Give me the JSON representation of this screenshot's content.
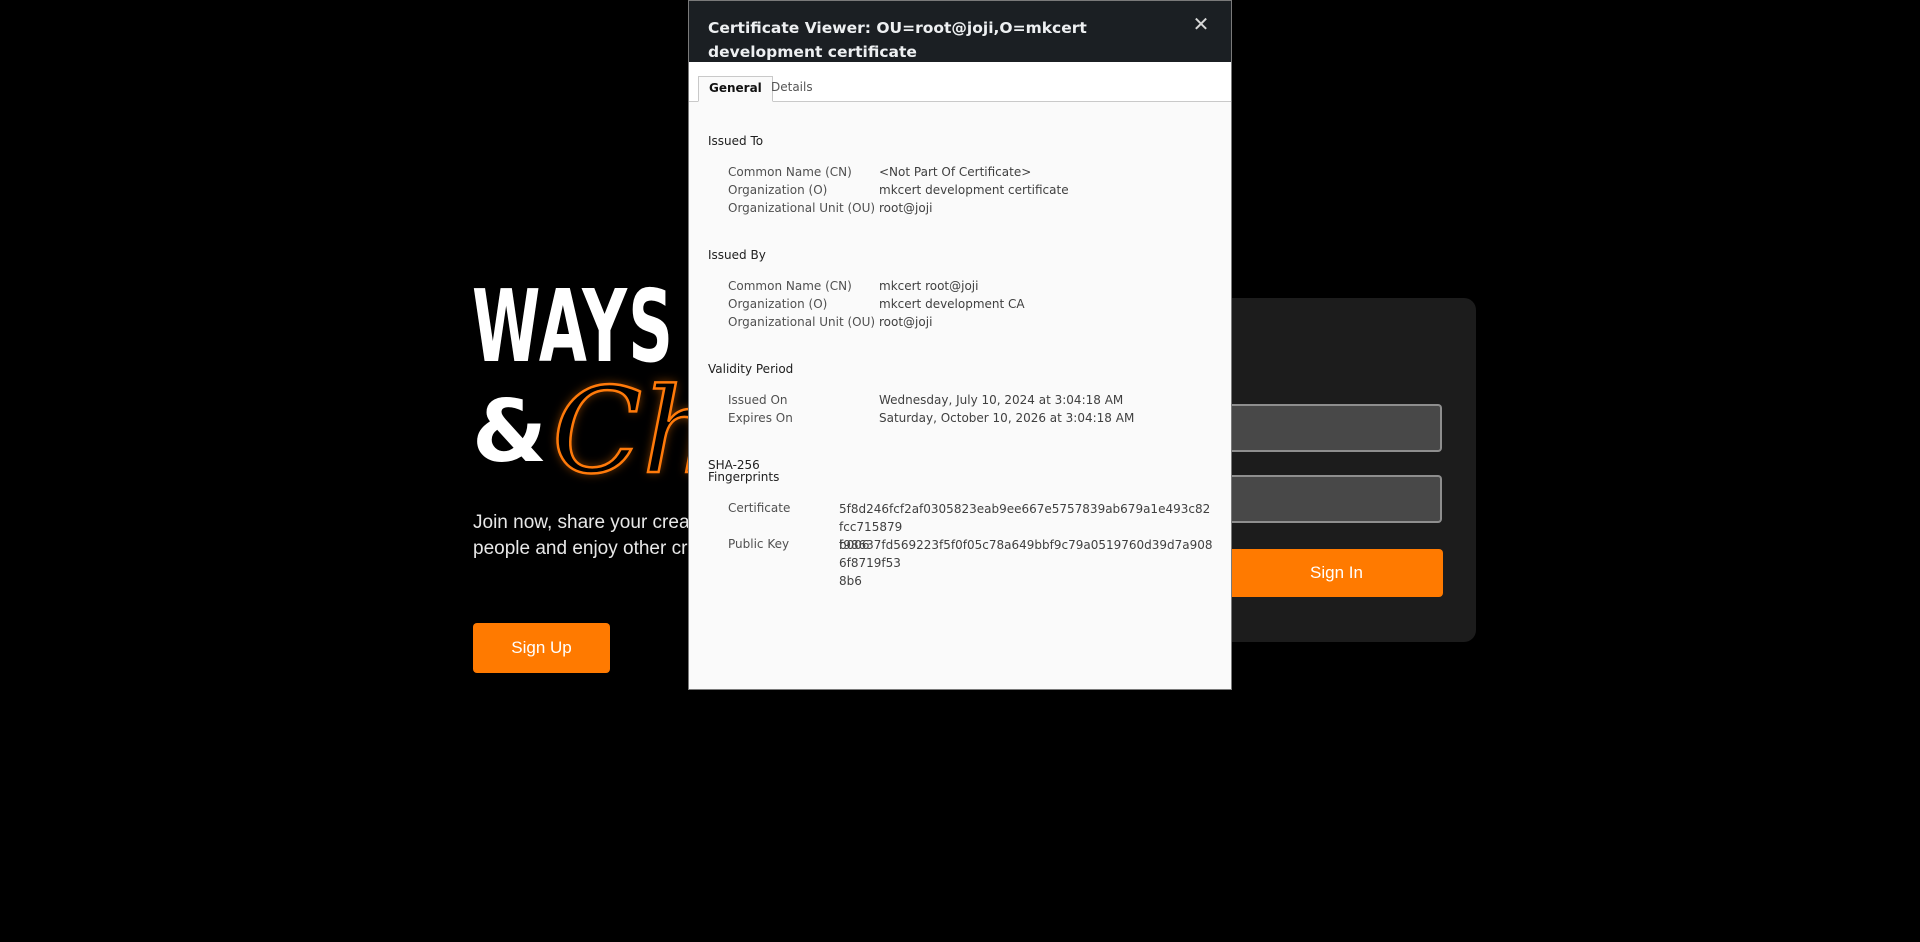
{
  "background": {
    "hero_line1": "WAYS",
    "hero_amp": "&",
    "hero_script": "Chi",
    "hero_desc_line1": "Join now, share your creati",
    "hero_desc_line2": "people and enjoy other cre",
    "signup_label": "Sign Up",
    "signin_label": "Sign In",
    "accent_color": "#ff7a00"
  },
  "dialog": {
    "title": "Certificate Viewer: OU=root@joji,O=mkcert development certificate",
    "close_icon": "close-icon",
    "tabs": [
      {
        "label": "General",
        "active": true
      },
      {
        "label": "Details",
        "active": false
      }
    ],
    "issued_to": {
      "title": "Issued To",
      "rows": [
        {
          "label": "Common Name (CN)",
          "value": "<Not Part Of Certificate>"
        },
        {
          "label": "Organization (O)",
          "value": "mkcert development certificate"
        },
        {
          "label": "Organizational Unit (OU)",
          "value": "root@joji"
        }
      ]
    },
    "issued_by": {
      "title": "Issued By",
      "rows": [
        {
          "label": "Common Name (CN)",
          "value": "mkcert root@joji"
        },
        {
          "label": "Organization (O)",
          "value": "mkcert development CA"
        },
        {
          "label": "Organizational Unit (OU)",
          "value": "root@joji"
        }
      ]
    },
    "validity": {
      "title": "Validity Period",
      "rows": [
        {
          "label": "Issued On",
          "value": "Wednesday, July 10, 2024 at 3:04:18 AM"
        },
        {
          "label": "Expires On",
          "value": "Saturday, October 10, 2026 at 3:04:18 AM"
        }
      ]
    },
    "fingerprints": {
      "title_line1": "SHA-256",
      "title_line2": "Fingerprints",
      "rows": [
        {
          "label": "Certificate",
          "value_line1": "5f8d246fcf2af0305823eab9ee667e5757839ab679a1e493c82fcc715879",
          "value_line2": "b006"
        },
        {
          "label": "Public Key",
          "value_line1": "f98637fd569223f5f0f05c78a649bbf9c79a0519760d39d7a9086f8719f53",
          "value_line2": "8b6"
        }
      ]
    }
  }
}
